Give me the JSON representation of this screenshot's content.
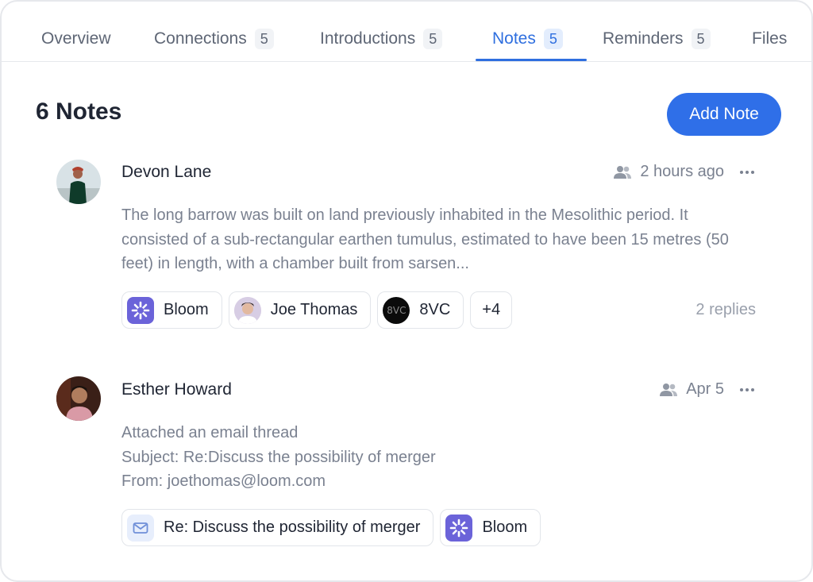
{
  "tabs": [
    {
      "label": "Overview",
      "count": ""
    },
    {
      "label": "Connections",
      "count": "5"
    },
    {
      "label": "Introductions",
      "count": "5"
    },
    {
      "label": "Notes",
      "count": "5"
    },
    {
      "label": "Reminders",
      "count": "5"
    },
    {
      "label": "Files",
      "count": ""
    }
  ],
  "active_tab": "Notes",
  "header": {
    "title": "6 Notes",
    "add_button": "Add Note"
  },
  "notes": [
    {
      "author": "Devon Lane",
      "time": "2 hours ago",
      "body": "The long barrow was built on land previously inhabited in the Mesolithic period. It consisted of a sub-rectangular earthen tumulus, estimated to have been 15 metres (50 feet) in length, with a chamber built from sarsen...",
      "chips": [
        {
          "label": "Bloom",
          "icon": "bloom-logo-icon"
        },
        {
          "label": "Joe Thomas",
          "icon": "avatar"
        },
        {
          "label": "8VC",
          "icon": "8vc-logo-icon",
          "icon_text": "8VC"
        },
        {
          "label": "+4"
        }
      ],
      "replies": "2 replies"
    },
    {
      "author": "Esther Howard",
      "time": "Apr 5",
      "body_lines": [
        "Attached an email thread",
        "Subject: Re:Discuss the possibility of merger",
        "From: joethomas@loom.com"
      ],
      "chips": [
        {
          "label": "Re: Discuss the possibility of merger",
          "icon": "mail-icon"
        },
        {
          "label": "Bloom",
          "icon": "bloom-logo-icon"
        }
      ]
    }
  ],
  "colors": {
    "accent": "#2f6fe8",
    "bloom": "#6b63d9",
    "muted_text": "#7a8190"
  }
}
